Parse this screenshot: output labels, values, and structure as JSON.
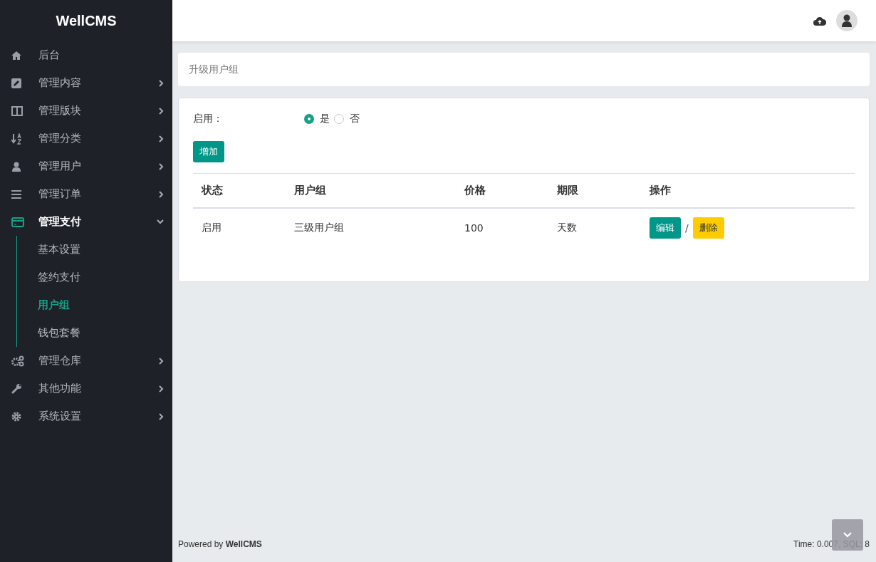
{
  "brand": "WellCMS",
  "sidebar": {
    "items": [
      {
        "label": "后台",
        "kind": "home"
      },
      {
        "label": "管理内容",
        "kind": "edit",
        "expanded": false
      },
      {
        "label": "管理版块",
        "kind": "columns",
        "expanded": false
      },
      {
        "label": "管理分类",
        "kind": "sort",
        "expanded": false
      },
      {
        "label": "管理用户",
        "kind": "user",
        "expanded": false
      },
      {
        "label": "管理订单",
        "kind": "list",
        "expanded": false
      },
      {
        "label": "管理支付",
        "kind": "card",
        "expanded": true,
        "children": [
          {
            "label": "基本设置",
            "selected": false
          },
          {
            "label": "签约支付",
            "selected": false
          },
          {
            "label": "用户组",
            "selected": true
          },
          {
            "label": "钱包套餐",
            "selected": false
          }
        ]
      },
      {
        "label": "管理仓库",
        "kind": "gears",
        "expanded": false
      },
      {
        "label": "其他功能",
        "kind": "wrench",
        "expanded": false
      },
      {
        "label": "系统设置",
        "kind": "gear",
        "expanded": false
      }
    ]
  },
  "breadcrumb": "升级用户组",
  "form": {
    "label": "启用：",
    "options": [
      {
        "label": "是",
        "selected": true
      },
      {
        "label": "否",
        "selected": false
      }
    ]
  },
  "add_button": "增加",
  "table": {
    "columns": [
      "状态",
      "用户组",
      "价格",
      "期限",
      "操作"
    ],
    "rows": [
      {
        "cells": [
          "启用",
          "三级用户组",
          "100",
          "天数"
        ],
        "actions": [
          {
            "label": "编辑",
            "kind": "primary"
          },
          {
            "label": "删除",
            "kind": "warning"
          }
        ],
        "separator": "/"
      }
    ]
  },
  "footer": {
    "powered": "Powered by **WellCMS**",
    "stats": "Time: 0.007, SQL: 8"
  }
}
